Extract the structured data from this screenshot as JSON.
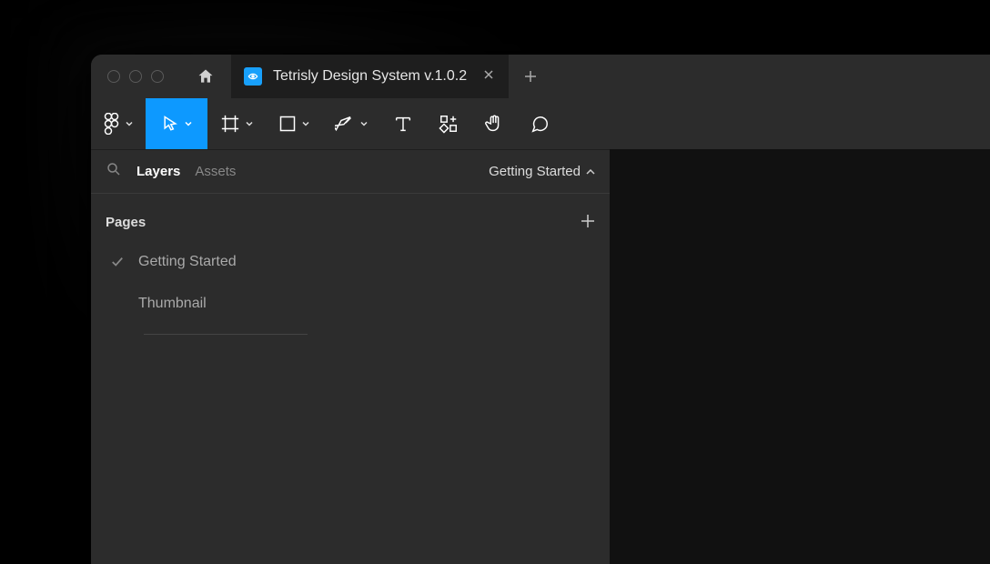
{
  "tab": {
    "title": "Tetrisly Design System v.1.0.2"
  },
  "panel": {
    "tabs": {
      "layers": "Layers",
      "assets": "Assets"
    },
    "current_page": "Getting Started",
    "pages_label": "Pages",
    "pages": [
      {
        "name": "Getting Started",
        "selected": true
      },
      {
        "name": "Thumbnail",
        "selected": false
      }
    ]
  }
}
